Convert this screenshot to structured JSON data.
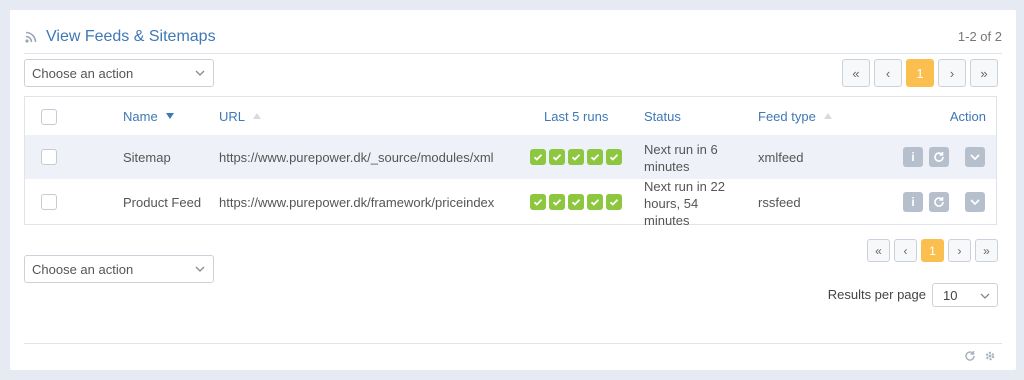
{
  "header": {
    "title": "View Feeds & Sitemaps",
    "count": "1-2 of 2",
    "icon": "rss-icon"
  },
  "action_select_top": {
    "value": "Choose an action"
  },
  "action_select_bottom": {
    "value": "Choose an action"
  },
  "pager": {
    "first": "«",
    "prev": "‹",
    "current": "1",
    "next": "›",
    "last": "»"
  },
  "table": {
    "columns": {
      "name": "Name",
      "url": "URL",
      "runs": "Last 5 runs",
      "status": "Status",
      "feed_type": "Feed type",
      "action": "Action"
    },
    "rows": [
      {
        "name": "Sitemap",
        "url": "https://www.purepower.dk/_source/modules/xml",
        "runs": [
          "success",
          "success",
          "success",
          "success",
          "success"
        ],
        "status": "Next run in 6 minutes",
        "feed_type": "xmlfeed"
      },
      {
        "name": "Product Feed",
        "url": "https://www.purepower.dk/framework/priceindex",
        "runs": [
          "success",
          "success",
          "success",
          "success",
          "success"
        ],
        "status": "Next run in 22 hours, 54 minutes",
        "feed_type": "rssfeed"
      }
    ]
  },
  "results_per_page": {
    "label": "Results per page",
    "value": "10"
  },
  "colors": {
    "accent": "#3f78b5",
    "active_page": "#fbbf4f",
    "run_success": "#8dc63f",
    "action_button": "#b6bfcc"
  }
}
